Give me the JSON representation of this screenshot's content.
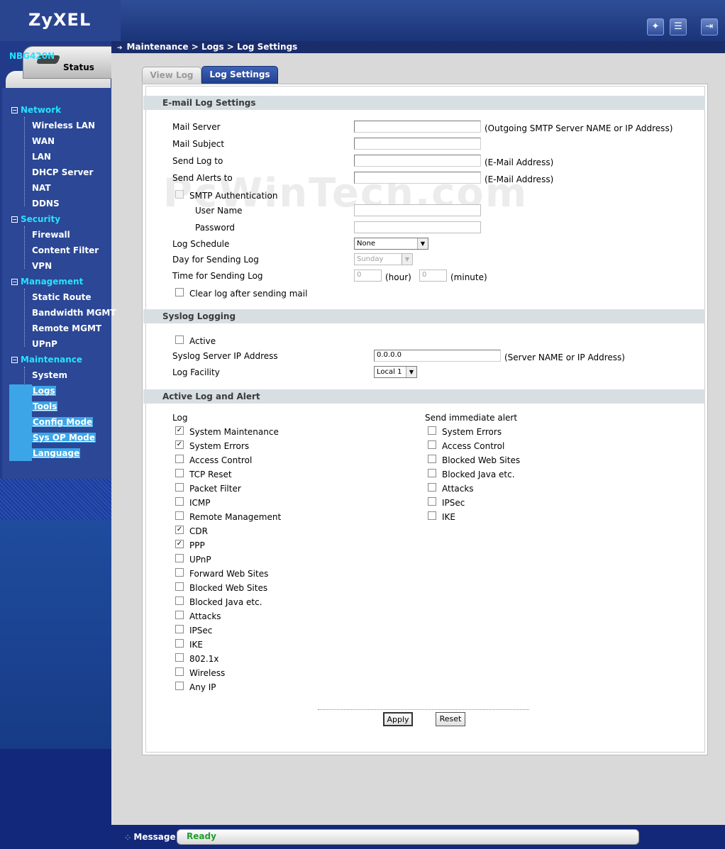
{
  "brand": {
    "logo_text": "ZyXEL"
  },
  "top_icons": [
    {
      "name": "wizard-icon",
      "glyph": "✦"
    },
    {
      "name": "notes-icon",
      "glyph": "☰"
    },
    {
      "name": "logout-icon",
      "glyph": "⇥"
    }
  ],
  "breadcrumb": "Maintenance > Logs > Log Settings",
  "status_tab": "Status",
  "sidebar": {
    "device": "NBG420N",
    "categories": {
      "network": "Network",
      "security": "Security",
      "management": "Management",
      "maintenance": "Maintenance"
    },
    "items": {
      "wireless_lan": "Wireless LAN",
      "wan": "WAN",
      "lan": "LAN",
      "dhcp_server": "DHCP Server",
      "nat": "NAT",
      "ddns": "DDNS",
      "firewall": "Firewall",
      "content_filter": "Content Filter",
      "vpn": "VPN",
      "static_route": "Static Route",
      "bandwidth_mgmt": "Bandwidth MGMT",
      "remote_mgmt": "Remote MGMT",
      "upnp": "UPnP",
      "system": "System",
      "logs": "Logs",
      "tools": "Tools",
      "config_mode": "Config Mode",
      "sys_op_mode": "Sys OP Mode",
      "language": "Language"
    }
  },
  "tabs": {
    "view_log": "View Log",
    "log_settings": "Log Settings"
  },
  "email": {
    "title": "E-mail Log Settings",
    "mail_server": "Mail Server",
    "mail_server_hint": "(Outgoing SMTP Server NAME or IP Address)",
    "mail_subject": "Mail Subject",
    "send_log_to": "Send Log to",
    "send_log_hint": "(E-Mail Address)",
    "send_alerts_to": "Send Alerts to",
    "send_alerts_hint": "(E-Mail Address)",
    "smtp_auth": "SMTP Authentication",
    "user_name": "User Name",
    "password": "Password",
    "log_schedule": "Log Schedule",
    "log_schedule_value": "None",
    "day_for_sending": "Day for Sending Log",
    "day_value": "Sunday",
    "time_for_sending": "Time for Sending Log",
    "hour_value": "0",
    "hour_label": "(hour)",
    "minute_value": "0",
    "minute_label": "(minute)",
    "clear_log": "Clear log after sending mail"
  },
  "syslog": {
    "title": "Syslog Logging",
    "active": "Active",
    "server_ip_label": "Syslog Server IP Address",
    "server_ip_value": "0.0.0.0",
    "server_hint": "(Server NAME or IP Address)",
    "facility_label": "Log Facility",
    "facility_value": "Local 1"
  },
  "active_log": {
    "title": "Active Log and Alert",
    "log_header": "Log",
    "alert_header": "Send immediate alert",
    "log_items": [
      {
        "label": "System Maintenance",
        "checked": true
      },
      {
        "label": "System Errors",
        "checked": true
      },
      {
        "label": "Access Control",
        "checked": false
      },
      {
        "label": "TCP Reset",
        "checked": false
      },
      {
        "label": "Packet Filter",
        "checked": false
      },
      {
        "label": "ICMP",
        "checked": false
      },
      {
        "label": "Remote Management",
        "checked": false
      },
      {
        "label": "CDR",
        "checked": true
      },
      {
        "label": "PPP",
        "checked": true
      },
      {
        "label": "UPnP",
        "checked": false
      },
      {
        "label": "Forward Web Sites",
        "checked": false
      },
      {
        "label": "Blocked Web Sites",
        "checked": false
      },
      {
        "label": "Blocked Java etc.",
        "checked": false
      },
      {
        "label": "Attacks",
        "checked": false
      },
      {
        "label": "IPSec",
        "checked": false
      },
      {
        "label": "IKE",
        "checked": false
      },
      {
        "label": "802.1x",
        "checked": false
      },
      {
        "label": "Wireless",
        "checked": false
      },
      {
        "label": "Any IP",
        "checked": false
      }
    ],
    "alert_items": [
      {
        "label": "System Errors",
        "checked": false
      },
      {
        "label": "Access Control",
        "checked": false
      },
      {
        "label": "Blocked Web Sites",
        "checked": false
      },
      {
        "label": "Blocked Java etc.",
        "checked": false
      },
      {
        "label": "Attacks",
        "checked": false
      },
      {
        "label": "IPSec",
        "checked": false
      },
      {
        "label": "IKE",
        "checked": false
      }
    ]
  },
  "buttons": {
    "apply": "Apply",
    "reset": "Reset"
  },
  "message": {
    "label": "Message",
    "status": "Ready"
  },
  "watermark": "PcWinTech.com",
  "colors": {
    "nav_accent": "#27e1ff",
    "highlight": "#3ca5e8",
    "ready": "#1f9e2a"
  }
}
